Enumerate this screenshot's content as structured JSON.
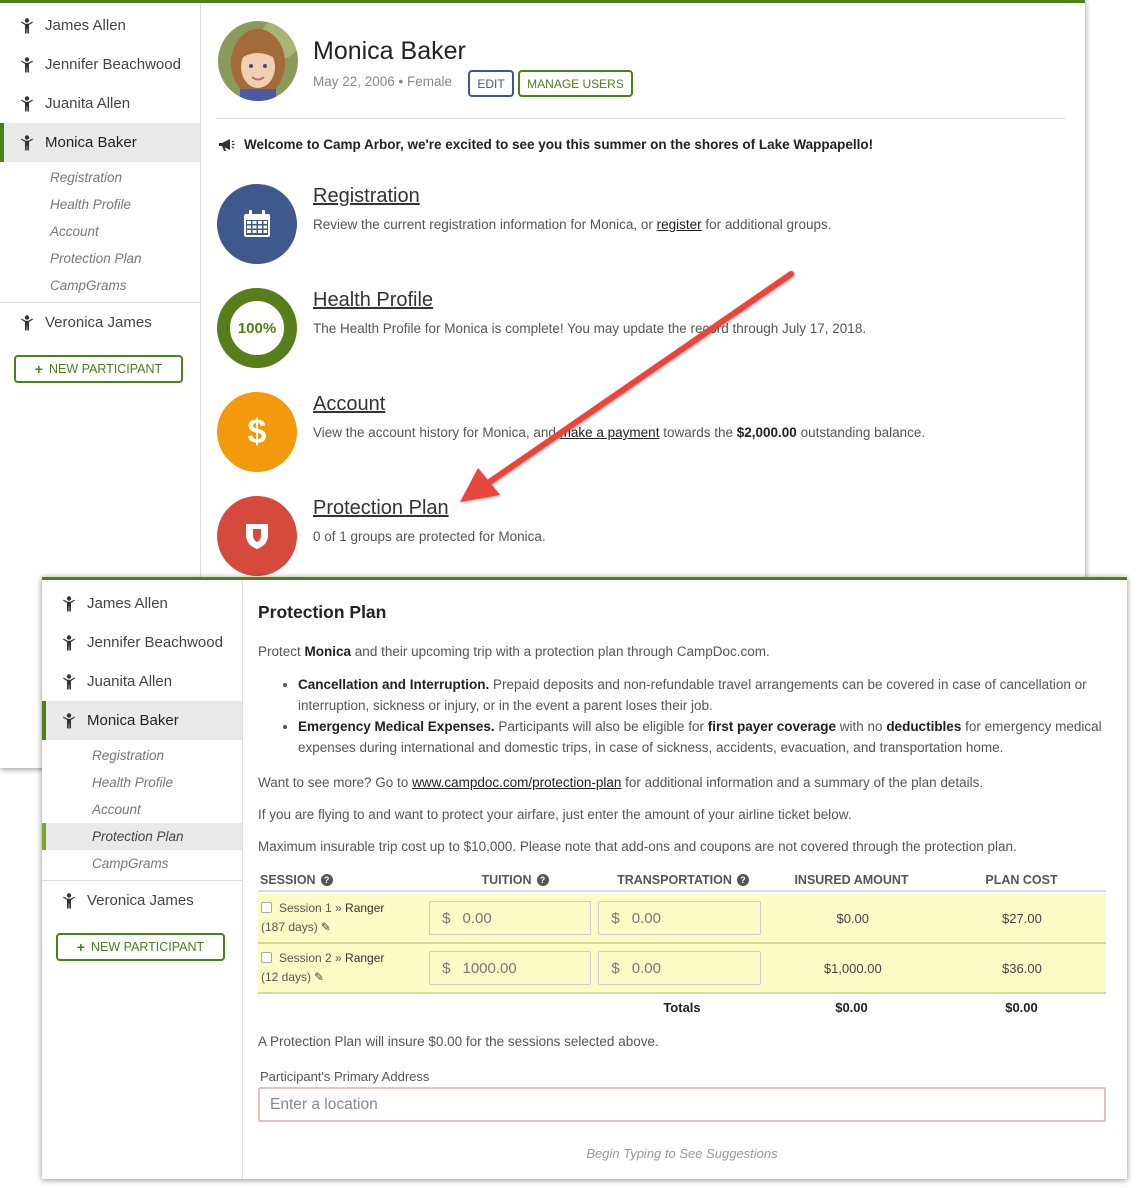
{
  "participants": [
    {
      "name": "James Allen"
    },
    {
      "name": "Jennifer Beachwood"
    },
    {
      "name": "Juanita Allen"
    },
    {
      "name": "Monica Baker"
    },
    {
      "name": "Veronica James"
    }
  ],
  "sub_nav": [
    "Registration",
    "Health Profile",
    "Account",
    "Protection Plan",
    "CampGrams"
  ],
  "new_participant_label": "NEW PARTICIPANT",
  "profile": {
    "name": "Monica Baker",
    "meta": "May 22, 2006 • Female",
    "edit_label": "EDIT",
    "manage_label": "MANAGE USERS"
  },
  "welcome_text": "Welcome to Camp Arbor, we're excited to see you this summer on the shores of Lake Wappapello!",
  "sections": {
    "registration": {
      "title": "Registration",
      "desc_pre": "Review the current registration information for Monica, or ",
      "desc_link": "register",
      "desc_post": " for additional groups."
    },
    "health": {
      "title": "Health Profile",
      "percent": "100%",
      "desc": "The Health Profile for Monica is complete! You may update the record through July 17, 2018."
    },
    "account": {
      "title": "Account",
      "symbol": "$",
      "desc_pre": "View the account history for Monica, and ",
      "desc_link": "make a payment",
      "desc_mid": " towards the ",
      "balance": "$2,000.00",
      "desc_post": " outstanding balance."
    },
    "protection": {
      "title": "Protection Plan",
      "desc": "0 of 1 groups are protected for Monica."
    }
  },
  "plan": {
    "title": "Protection Plan",
    "intro_pre": "Protect ",
    "intro_name": "Monica",
    "intro_post": " and their upcoming trip with a protection plan through CampDoc.com.",
    "bullet1_title": "Cancellation and Interruption.",
    "bullet1_text": " Prepaid deposits and non-refundable travel arrangements can be covered in case of cancellation or interruption, sickness or injury, or in the event a parent loses their job.",
    "bullet2_title": "Emergency Medical Expenses.",
    "bullet2_a": " Participants will also be eligible for ",
    "bullet2_b": "first payer coverage",
    "bullet2_c": " with no ",
    "bullet2_d": "deductibles",
    "bullet2_e": " for emergency medical expenses during international and domestic trips, in case of sickness, accidents, evacuation, and transportation home.",
    "more_pre": "Want to see more? Go to ",
    "more_link": "www.campdoc.com/protection-plan",
    "more_post": " for additional information and a summary of the plan details.",
    "flying": "If you are flying to and want to protect your airfare, just enter the amount of your airline ticket below.",
    "maximum": "Maximum insurable trip cost up to $10,000. Please note that add-ons and coupons are not covered through the protection plan.",
    "table": {
      "headers": [
        "SESSION",
        "TUITION",
        "TRANSPORTATION",
        "INSURED AMOUNT",
        "PLAN COST"
      ],
      "currency": "$",
      "rows": [
        {
          "session": "Session 1",
          "group": "Ranger",
          "days": "(187 days)",
          "tuition": "0.00",
          "transport": "0.00",
          "insured": "$0.00",
          "cost": "$27.00"
        },
        {
          "session": "Session 2",
          "group": "Ranger",
          "days": "(12 days)",
          "tuition": "1000.00",
          "transport": "0.00",
          "insured": "$1,000.00",
          "cost": "$36.00"
        }
      ],
      "totals_label": "Totals",
      "total_insured": "$0.00",
      "total_cost": "$0.00"
    },
    "insure_text": "A Protection Plan will insure $0.00 for the sessions selected above.",
    "address_label": "Participant's Primary Address",
    "address_placeholder": "Enter a location",
    "suggestion_hint": "Begin Typing to See Suggestions"
  },
  "colors": {
    "brand_green": "#4d7f1b",
    "registration_blue": "#40598d",
    "health_green": "#567f1b",
    "account_orange": "#f29a0b",
    "protection_red": "#d64a3d",
    "arrow_red": "#e8453c",
    "table_highlight": "#fbfbc6"
  },
  "icons": [
    "person-icon",
    "megaphone-icon",
    "calendar-icon",
    "dollar-icon",
    "shield-icon",
    "help-icon",
    "pencil-icon",
    "plus-icon"
  ]
}
